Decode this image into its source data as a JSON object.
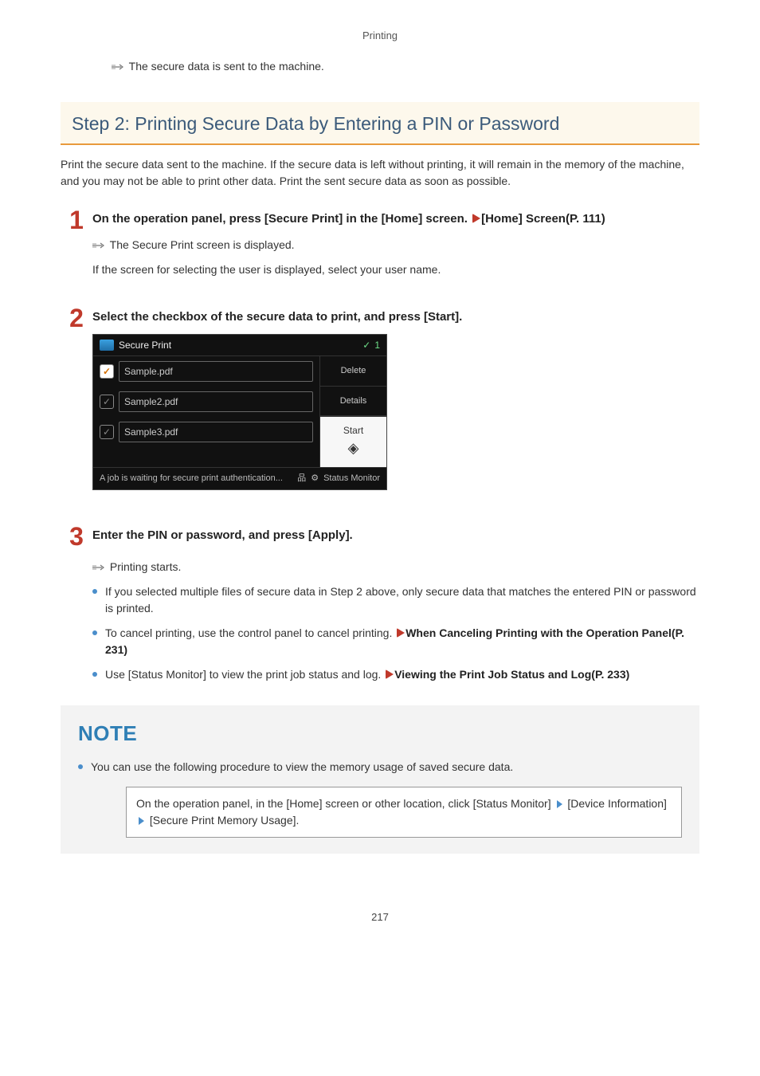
{
  "header": {
    "label": "Printing"
  },
  "intro_result": "The secure data is sent to the machine.",
  "section_heading": "Step 2: Printing Secure Data by Entering a PIN or Password",
  "intro_para": "Print the secure data sent to the machine. If the secure data is left without printing, it will remain in the memory of the machine, and you may not be able to print other data. Print the sent secure data as soon as possible.",
  "steps": {
    "s1": {
      "num": "1",
      "title_a": "On the operation panel, press [Secure Print] in the [Home] screen. ",
      "link_label": "[Home] Screen(P. 111)",
      "result": "The Secure Print screen is displayed.",
      "body": "If the screen for selecting the user is displayed, select your user name."
    },
    "s2": {
      "num": "2",
      "title": "Select the checkbox of the secure data to print, and press [Start]."
    },
    "s3": {
      "num": "3",
      "title": "Enter the PIN or password, and press [Apply].",
      "result": "Printing starts.",
      "bullets": {
        "b1": "If you selected multiple files of secure data in Step 2 above, only secure data that matches the entered PIN or password is printed.",
        "b2_a": "To cancel printing, use the control panel to cancel printing. ",
        "b2_link": "When Canceling Printing with the Operation Panel(P. 231)",
        "b3_a": "Use [Status Monitor] to view the print job status and log. ",
        "b3_link": "Viewing the Print Job Status and Log(P. 233)"
      }
    }
  },
  "screenshot": {
    "title": "Secure Print",
    "count": "1",
    "files": {
      "f1": "Sample.pdf",
      "f2": "Sample2.pdf",
      "f3": "Sample3.pdf"
    },
    "side": {
      "delete": "Delete",
      "details": "Details",
      "start": "Start"
    },
    "footer_msg": "A job is waiting for secure print authentication...",
    "status_monitor": "Status Monitor"
  },
  "note": {
    "title": "NOTE",
    "bullet": "You can use the following procedure to view the memory usage of saved secure data.",
    "proc_a": "On the operation panel, in the [Home] screen or other location, click [Status Monitor] ",
    "proc_b": " [Device Information] ",
    "proc_c": " [Secure Print Memory Usage]."
  },
  "page_number": "217"
}
